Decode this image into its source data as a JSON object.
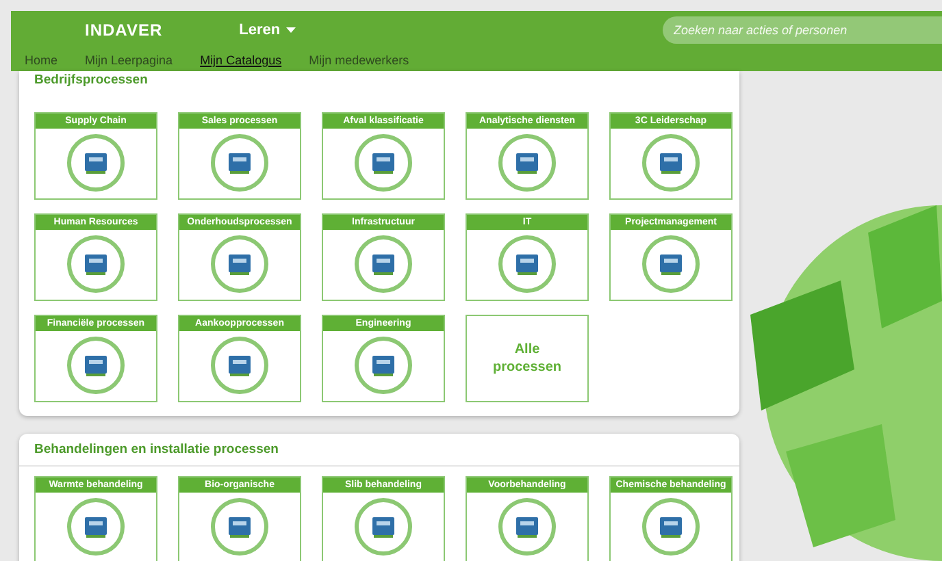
{
  "header": {
    "logo": "INDAVER",
    "menu": "Leren",
    "search": {
      "placeholder": "Zoeken naar acties of personen"
    }
  },
  "nav": [
    {
      "label": "Home",
      "selected": false
    },
    {
      "label": "Mijn Leerpagina",
      "selected": false
    },
    {
      "label": "Mijn Catalogus",
      "selected": true
    },
    {
      "label": "Mijn medewerkers",
      "selected": false
    }
  ],
  "sections": [
    {
      "title": "Bedrijfsprocessen",
      "tiles": [
        {
          "kind": "process",
          "label": "Supply Chain"
        },
        {
          "kind": "process",
          "label": "Sales processen"
        },
        {
          "kind": "process",
          "label": "Afval klassificatie"
        },
        {
          "kind": "process",
          "label": "Analytische diensten"
        },
        {
          "kind": "process",
          "label": "3C Leiderschap"
        },
        {
          "kind": "process",
          "label": "Human Resources"
        },
        {
          "kind": "process",
          "label": "Onderhoudsprocessen"
        },
        {
          "kind": "process",
          "label": "Infrastructuur"
        },
        {
          "kind": "process",
          "label": "IT"
        },
        {
          "kind": "process",
          "label": "Projectmanagement"
        },
        {
          "kind": "process",
          "label": "Financiële processen"
        },
        {
          "kind": "process",
          "label": "Aankoopprocessen"
        },
        {
          "kind": "process",
          "label": "Engineering"
        },
        {
          "kind": "all",
          "label": "Alle processen"
        }
      ]
    },
    {
      "title": "Behandelingen en installatie processen",
      "tiles": [
        {
          "kind": "process",
          "label": "Warmte behandeling"
        },
        {
          "kind": "process",
          "label": "Bio-organische"
        },
        {
          "kind": "process",
          "label": "Slib behandeling"
        },
        {
          "kind": "process",
          "label": "Voorbehandeling"
        },
        {
          "kind": "process",
          "label": "Chemische behandeling"
        }
      ]
    }
  ]
}
